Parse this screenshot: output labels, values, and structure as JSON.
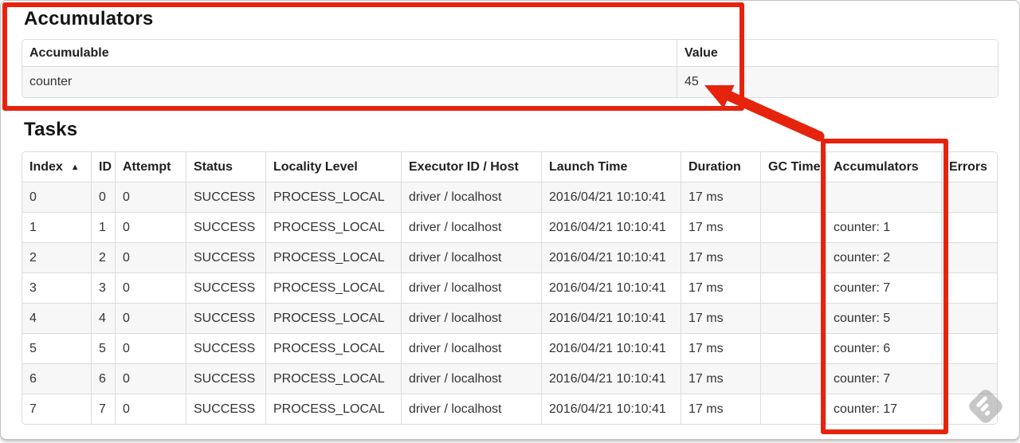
{
  "annotations": {
    "highlight_color": "#e6230d",
    "watermark_icon": "feedly-logo-icon"
  },
  "accumulators_section": {
    "title": "Accumulators",
    "table": {
      "headers": [
        "Accumulable",
        "Value"
      ],
      "rows": [
        [
          "counter",
          "45"
        ]
      ]
    }
  },
  "tasks_section": {
    "title": "Tasks",
    "table": {
      "headers": [
        "Index",
        "ID",
        "Attempt",
        "Status",
        "Locality Level",
        "Executor ID / Host",
        "Launch Time",
        "Duration",
        "GC Time",
        "Accumulators",
        "Errors"
      ],
      "sort": {
        "column": "Index",
        "direction": "ascending",
        "indicator": "▲"
      },
      "rows": [
        [
          "0",
          "0",
          "0",
          "SUCCESS",
          "PROCESS_LOCAL",
          "driver / localhost",
          "2016/04/21 10:10:41",
          "17 ms",
          "",
          "",
          ""
        ],
        [
          "1",
          "1",
          "0",
          "SUCCESS",
          "PROCESS_LOCAL",
          "driver / localhost",
          "2016/04/21 10:10:41",
          "17 ms",
          "",
          "counter: 1",
          ""
        ],
        [
          "2",
          "2",
          "0",
          "SUCCESS",
          "PROCESS_LOCAL",
          "driver / localhost",
          "2016/04/21 10:10:41",
          "17 ms",
          "",
          "counter: 2",
          ""
        ],
        [
          "3",
          "3",
          "0",
          "SUCCESS",
          "PROCESS_LOCAL",
          "driver / localhost",
          "2016/04/21 10:10:41",
          "17 ms",
          "",
          "counter: 7",
          ""
        ],
        [
          "4",
          "4",
          "0",
          "SUCCESS",
          "PROCESS_LOCAL",
          "driver / localhost",
          "2016/04/21 10:10:41",
          "17 ms",
          "",
          "counter: 5",
          ""
        ],
        [
          "5",
          "5",
          "0",
          "SUCCESS",
          "PROCESS_LOCAL",
          "driver / localhost",
          "2016/04/21 10:10:41",
          "17 ms",
          "",
          "counter: 6",
          ""
        ],
        [
          "6",
          "6",
          "0",
          "SUCCESS",
          "PROCESS_LOCAL",
          "driver / localhost",
          "2016/04/21 10:10:41",
          "17 ms",
          "",
          "counter: 7",
          ""
        ],
        [
          "7",
          "7",
          "0",
          "SUCCESS",
          "PROCESS_LOCAL",
          "driver / localhost",
          "2016/04/21 10:10:41",
          "17 ms",
          "",
          "counter: 17",
          ""
        ]
      ]
    }
  }
}
